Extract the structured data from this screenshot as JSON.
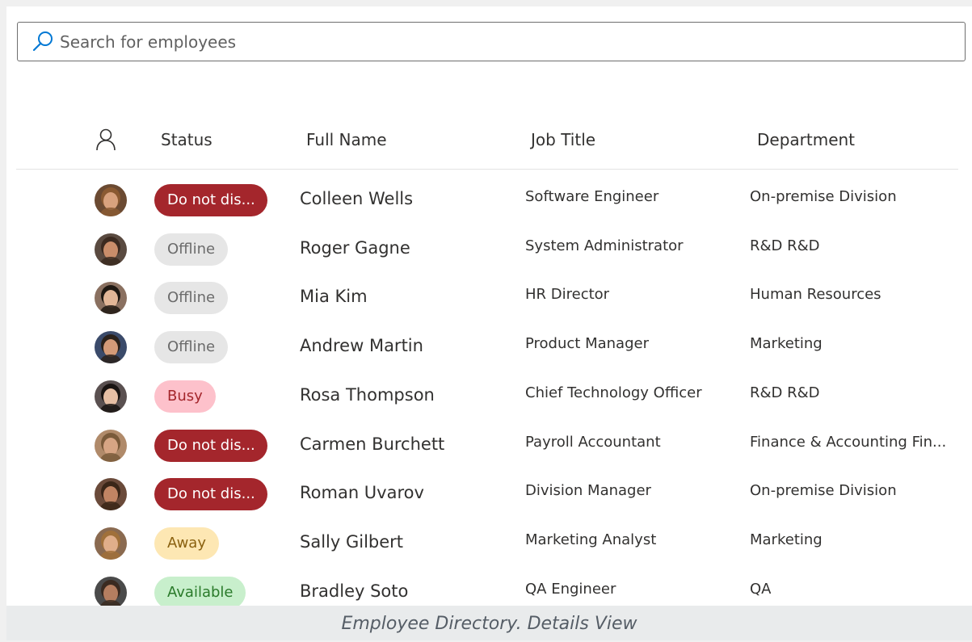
{
  "search": {
    "placeholder": "Search for employees",
    "value": ""
  },
  "table": {
    "columns": [
      "Status",
      "Full Name",
      "Job Title",
      "Department"
    ],
    "rows": [
      {
        "status": "Do not dis...",
        "status_kind": "dnd",
        "name": "Colleen Wells",
        "job": "Software Engineer",
        "dept": "On-premise Division"
      },
      {
        "status": "Offline",
        "status_kind": "offline",
        "name": "Roger Gagne",
        "job": "System Administrator",
        "dept": "R&D R&D"
      },
      {
        "status": "Offline",
        "status_kind": "offline",
        "name": "Mia Kim",
        "job": "HR Director",
        "dept": "Human Resources"
      },
      {
        "status": "Offline",
        "status_kind": "offline",
        "name": "Andrew Martin",
        "job": "Product Manager",
        "dept": "Marketing"
      },
      {
        "status": "Busy",
        "status_kind": "busy",
        "name": "Rosa Thompson",
        "job": "Chief Technology Officer",
        "dept": "R&D R&D"
      },
      {
        "status": "Do not dis...",
        "status_kind": "dnd",
        "name": "Carmen Burchett",
        "job": "Payroll Accountant",
        "dept": "Finance & Accounting Fin..."
      },
      {
        "status": "Do not dis...",
        "status_kind": "dnd",
        "name": "Roman Uvarov",
        "job": "Division Manager",
        "dept": "On-premise Division"
      },
      {
        "status": "Away",
        "status_kind": "away",
        "name": "Sally Gilbert",
        "job": "Marketing Analyst",
        "dept": "Marketing"
      },
      {
        "status": "Available",
        "status_kind": "available",
        "name": "Bradley Soto",
        "job": "QA Engineer",
        "dept": "QA"
      }
    ]
  },
  "caption": "Employee Directory. Details View",
  "colors": {
    "dnd": "#a4262c",
    "offline": "#e6e6e6",
    "busy": "#fdc1cb",
    "away": "#fde7b3",
    "available": "#c8efcc",
    "accent": "#0078d4"
  },
  "icons": {
    "search": "search-icon",
    "person": "person-icon"
  }
}
